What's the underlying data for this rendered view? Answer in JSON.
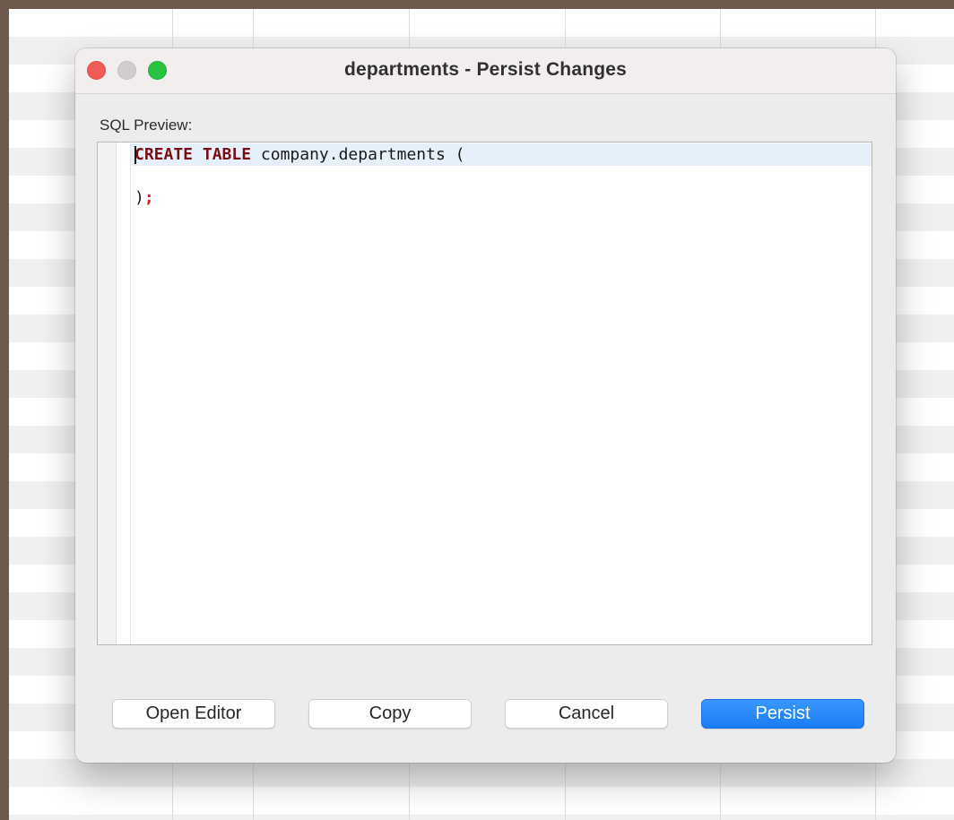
{
  "dialog": {
    "title": "departments - Persist Changes",
    "sql_label": "SQL Preview:",
    "code": {
      "line1_keyword1": "CREATE",
      "line1_keyword2": "TABLE",
      "line1_rest": " company.departments (",
      "line3_paren": ")",
      "line3_semicolon": ";"
    },
    "buttons": {
      "open_editor": "Open Editor",
      "copy": "Copy",
      "cancel": "Cancel",
      "persist": "Persist"
    }
  },
  "colors": {
    "keyword": "#7b0d12",
    "semicolon": "#e01b1b",
    "primary_button": "#1a7cf5",
    "traffic_close": "#f15b56",
    "traffic_minimize": "#d0cdcd",
    "traffic_zoom": "#2ac23f"
  },
  "icons": {
    "close": "close-icon",
    "minimize": "minimize-icon",
    "zoom": "zoom-icon"
  }
}
